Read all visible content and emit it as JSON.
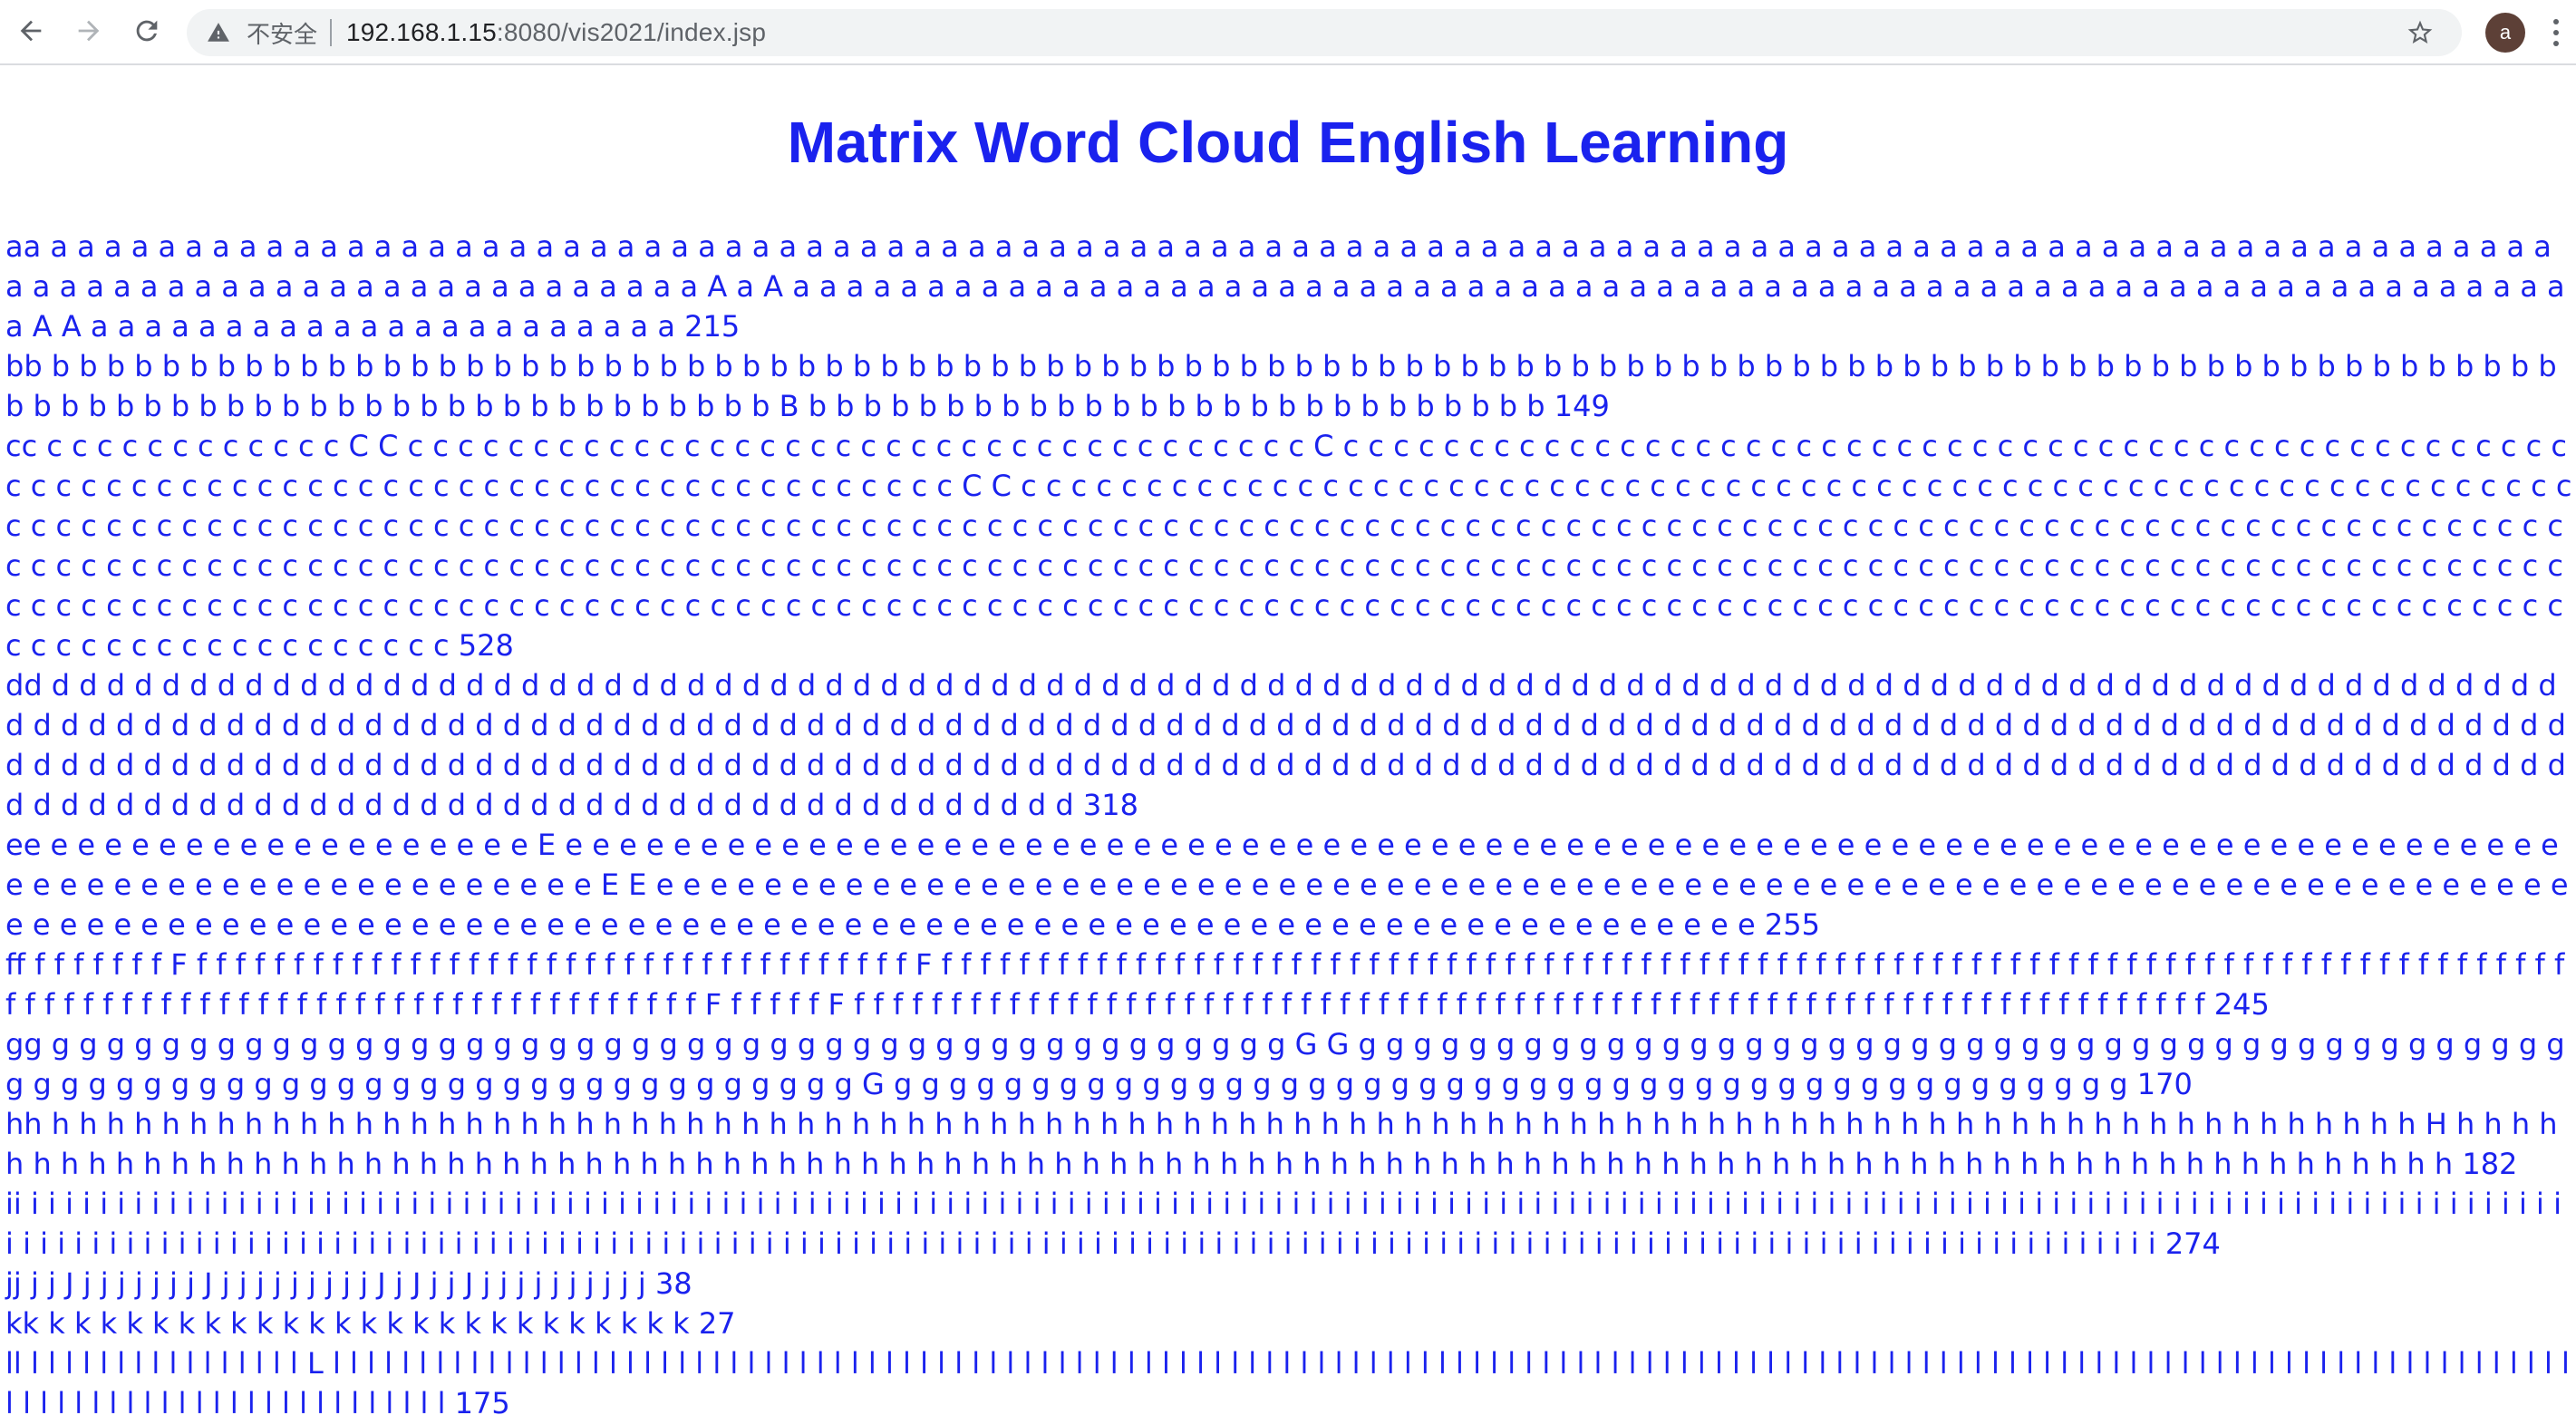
{
  "browser": {
    "insecure_label": "不安全",
    "url_host": "192.168.1.15",
    "url_rest": ":8080/vis2021/index.jsp",
    "avatar_letter": "a"
  },
  "page": {
    "title": "Matrix Word Cloud English Learning"
  },
  "word_cloud": [
    {
      "letter": "a",
      "count": 215,
      "upper_at": [
        121,
        123,
        191,
        192
      ],
      "upper": "A"
    },
    {
      "letter": "b",
      "count": 149,
      "upper_at": [
        121
      ],
      "upper": "B"
    },
    {
      "letter": "c",
      "count": 528,
      "upper_at": [
        14,
        15,
        52,
        140,
        141
      ],
      "upper": "C"
    },
    {
      "letter": "d",
      "count": 318,
      "upper_at": [],
      "upper": "D"
    },
    {
      "letter": "e",
      "count": 255,
      "upper_at": [
        20,
        117,
        118
      ],
      "upper": "E"
    },
    {
      "letter": "f",
      "count": 245,
      "upper_at": [
        9,
        47,
        168,
        174
      ],
      "upper": "F"
    },
    {
      "letter": "g",
      "count": 170,
      "upper_at": [
        47,
        48,
        124
      ],
      "upper": "G"
    },
    {
      "letter": "h",
      "count": 182,
      "upper_at": [
        88
      ],
      "upper": "H"
    },
    {
      "letter": "i",
      "count": 274,
      "upper_at": [],
      "upper": "I"
    },
    {
      "letter": "j",
      "count": 38,
      "upper_at": [
        4,
        12,
        22,
        24,
        27
      ],
      "upper": "J"
    },
    {
      "letter": "k",
      "count": 27,
      "upper_at": [],
      "upper": "K"
    },
    {
      "letter": "l",
      "count": 175,
      "upper_at": [
        18
      ],
      "upper": "L"
    }
  ]
}
